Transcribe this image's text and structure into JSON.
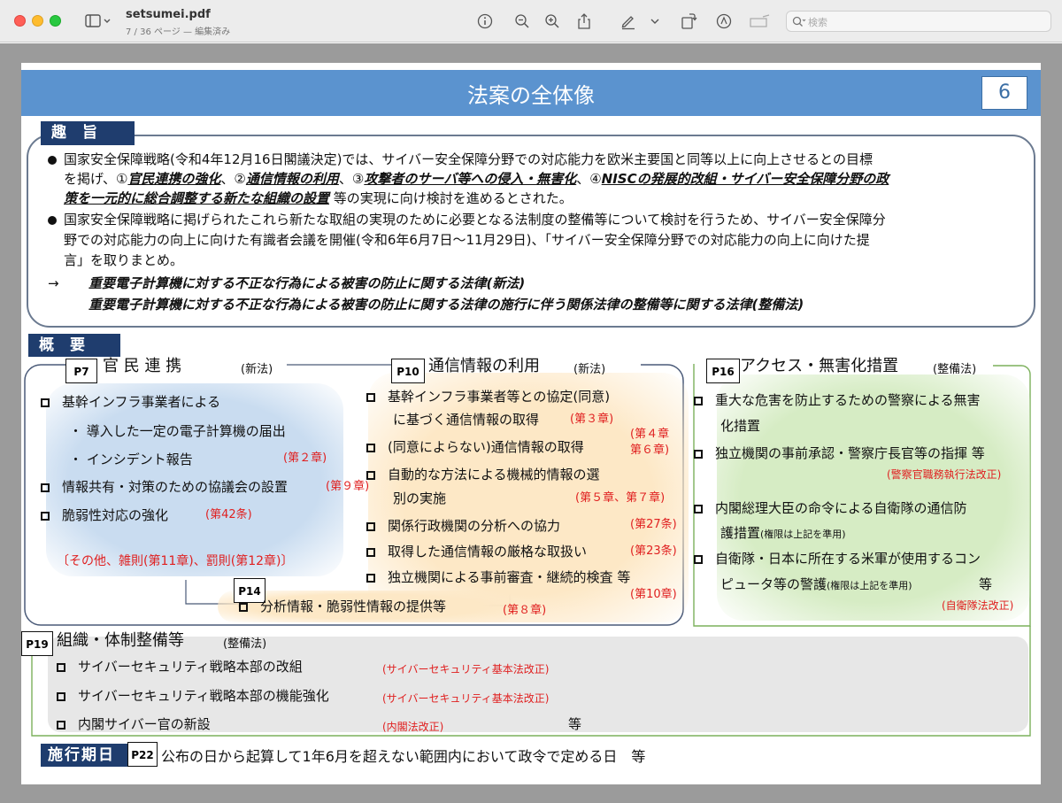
{
  "window": {
    "title": "setsumei.pdf",
    "subtitle": "7 / 36 ページ — 編集済み",
    "search_placeholder": "検索"
  },
  "slide": {
    "title": "法案の全体像",
    "page_number": "6",
    "shushi": {
      "tab": "趣旨",
      "b1_l1": "国家安全保障戦略(令和4年12月16日閣議決定)では、サイバー安全保障分野での対応能力を欧米主要国と同等以上に向上させるとの目標",
      "b1_l2_a": "を掲げ、①",
      "b1_l2_b": "官民連携の強化",
      "b1_l2_c": "、②",
      "b1_l2_d": "通信情報の利用",
      "b1_l2_e": "、③",
      "b1_l2_f": "攻撃者のサーバ等への侵入・無害化",
      "b1_l2_g": "、④",
      "b1_l2_h": "NISCの発展的改組・サイバー安全保障分野の政",
      "b1_l3_a": "策を一元的に総合調整する新たな組織の設置",
      "b1_l3_b": "等の実現に向け検討を進めるとされた。",
      "b2_l1": "国家安全保障戦略に掲げられたこれら新たな取組の実現のために必要となる法制度の整備等について検討を行うため、サイバー安全保障分",
      "b2_l2": "野での対応能力の向上に向けた有識者会議を開催(令和6年6月7日～11月29日)、「サイバー安全保障分野での対応能力の向上に向けた提",
      "b2_l3": "言」を取りまとめ。",
      "arrow": "→",
      "law1": "重要電子計算機に対する不正な行為による被害の防止に関する法律(新法)",
      "law2": "重要電子計算機に対する不正な行為による被害の防止に関する法律の施行に伴う関係法律の整備等に関する法律(整備法)"
    },
    "gaiyo": {
      "tab": "概要",
      "col1": {
        "page_tag": "P7",
        "title": "官 民 連 携",
        "kind": "(新法)",
        "item1": "基幹インフラ事業者による",
        "sub1": "・ 導入した一定の電子計算機の届出",
        "sub2": "・ インシデント報告",
        "sub2_ref": "(第２章)",
        "item2": "情報共有・対策のための協議会の設置",
        "item2_ref": "(第９章)",
        "item3": "脆弱性対応の強化",
        "item3_ref": "(第42条)",
        "other": "その他、雑則(第11章)、罰則(第12章)"
      },
      "col2": {
        "page_tag": "P10",
        "title": "通信情報の利用",
        "kind": "(新法)",
        "item1_l1": "基幹インフラ事業者等との協定(同意)",
        "item1_l2": "に基づく通信情報の取得",
        "item1_ref": "(第３章)",
        "item2": "(同意によらない)通信情報の取得",
        "item2_ref1": "(第４章",
        "item2_ref2": "第６章)",
        "item3_l1": "自動的な方法による機械的情報の選",
        "item3_l2": "別の実施",
        "item3_ref": "(第５章、第７章)",
        "item4": "関係行政機関の分析への協力",
        "item4_ref": "(第27条)",
        "item5": "取得した通信情報の厳格な取扱い",
        "item5_ref": "(第23条)",
        "item6": "独立機関による事前審査・継続的検査 等",
        "item6_ref": "(第10章)"
      },
      "col3": {
        "page_tag": "P16",
        "title": "アクセス・無害化措置",
        "kind": "(整備法)",
        "item1_l1": "重大な危害を防止するための警察による無害",
        "item1_l2": "化措置",
        "item2": "独立機関の事前承認・警察庁長官等の指揮 等",
        "item2_ref": "(警察官職務執行法改正)",
        "item3_l1": "内閣総理大臣の命令による自衛隊の通信防",
        "item3_l2": "護措置",
        "item3_note": "(権限は上記を準用)",
        "item4_l1": "自衛隊・日本に所在する米軍が使用するコン",
        "item4_l2": "ピュータ等の警護",
        "item4_note": "(権限は上記を準用)",
        "item4_etc": "等",
        "item4_ref": "(自衛隊法改正)"
      },
      "p14": {
        "page_tag": "P14",
        "item": "分析情報・脆弱性情報の提供等",
        "ref": "(第８章)"
      },
      "org": {
        "page_tag": "P19",
        "title": "組織・体制整備等",
        "kind": "(整備法)",
        "item1": "サイバーセキュリティ戦略本部の改組",
        "item1_ref": "(サイバーセキュリティ基本法改正)",
        "item2": "サイバーセキュリティ戦略本部の機能強化",
        "item2_ref": "(サイバーセキュリティ基本法改正)",
        "item3": "内閣サイバー官の新設",
        "item3_ref": "(内閣法改正)",
        "etc": "等"
      }
    },
    "enforcement": {
      "tab": "施行期日",
      "page_tag": "P22",
      "text": "公布の日から起算して1年6月を超えない範囲内において政令で定める日　等"
    }
  }
}
